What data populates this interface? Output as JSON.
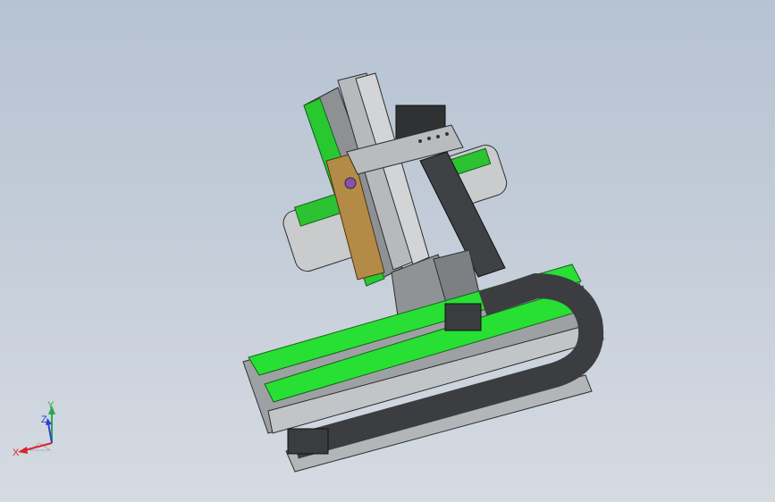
{
  "viewport": {
    "background_top": "#b6c3d3",
    "background_bottom": "#d6dbe2"
  },
  "model": {
    "accent_green": "#27e033",
    "body_gray": "#a9acae",
    "dark_gray": "#3f4144",
    "bracket_tan": "#b48a47"
  },
  "triad": {
    "x_label": "X",
    "y_label": "Y",
    "z_label": "Z",
    "x_color": "#d9262b",
    "y_color": "#2ea84a",
    "z_color": "#2a3fd6"
  }
}
